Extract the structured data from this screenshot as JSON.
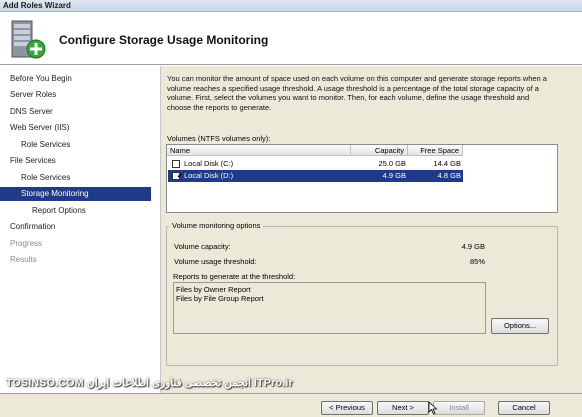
{
  "window": {
    "title": "Add Roles Wizard"
  },
  "header": {
    "title": "Configure Storage Usage Monitoring",
    "icon": "server-add-icon"
  },
  "nav": {
    "items": [
      {
        "label": "Before You Begin",
        "state": "normal"
      },
      {
        "label": "Server Roles",
        "state": "normal"
      },
      {
        "label": "DNS Server",
        "state": "normal"
      },
      {
        "label": "Web Server (IIS)",
        "state": "normal"
      },
      {
        "label": "Role Services",
        "state": "normal"
      },
      {
        "label": "File Services",
        "state": "normal"
      },
      {
        "label": "Role Services",
        "state": "normal"
      },
      {
        "label": "Storage Monitoring",
        "state": "active"
      },
      {
        "label": "Report Options",
        "state": "normal"
      },
      {
        "label": "Confirmation",
        "state": "normal"
      },
      {
        "label": "Progress",
        "state": "disabled"
      },
      {
        "label": "Results",
        "state": "disabled"
      }
    ]
  },
  "main": {
    "intro": "You can monitor the amount of space used on each volume on this computer and generate storage reports when a volume reaches a specified usage threshold. A usage threshold is a percentage of the total storage capacity of a volume. First, select the volumes you want to monitor. Then, for each volume, define the usage threshold and choose the reports to generate.",
    "volumes_label": "Volumes (NTFS volumes only):",
    "columns": {
      "name": "Name",
      "capacity": "Capacity",
      "free": "Free Space"
    },
    "volumes": [
      {
        "name": "Local Disk (C:)",
        "capacity": "25.0 GB",
        "free": "14.4 GB",
        "checked": false,
        "selected": false
      },
      {
        "name": "Local Disk (D:)",
        "capacity": "4.9 GB",
        "free": "4.8 GB",
        "checked": true,
        "selected": true
      }
    ],
    "options_group": {
      "legend": "Volume monitoring options",
      "capacity_label": "Volume capacity:",
      "capacity_value": "4.9 GB",
      "threshold_label": "Volume usage threshold:",
      "threshold_value": "85%",
      "reports_label": "Reports to generate at the threshold:",
      "reports": [
        "Files by Owner Report",
        "Files by File Group Report"
      ],
      "options_button": "Options..."
    }
  },
  "footer": {
    "previous": "< Previous",
    "next": "Next >",
    "install": "Install",
    "cancel": "Cancel",
    "watermark": "TOSINSO.COM انجمن تخصصی فناوری اطلاعات ایران ITPro.ir"
  },
  "colors": {
    "selection": "#1f3a86",
    "panel": "#ece9d8"
  }
}
